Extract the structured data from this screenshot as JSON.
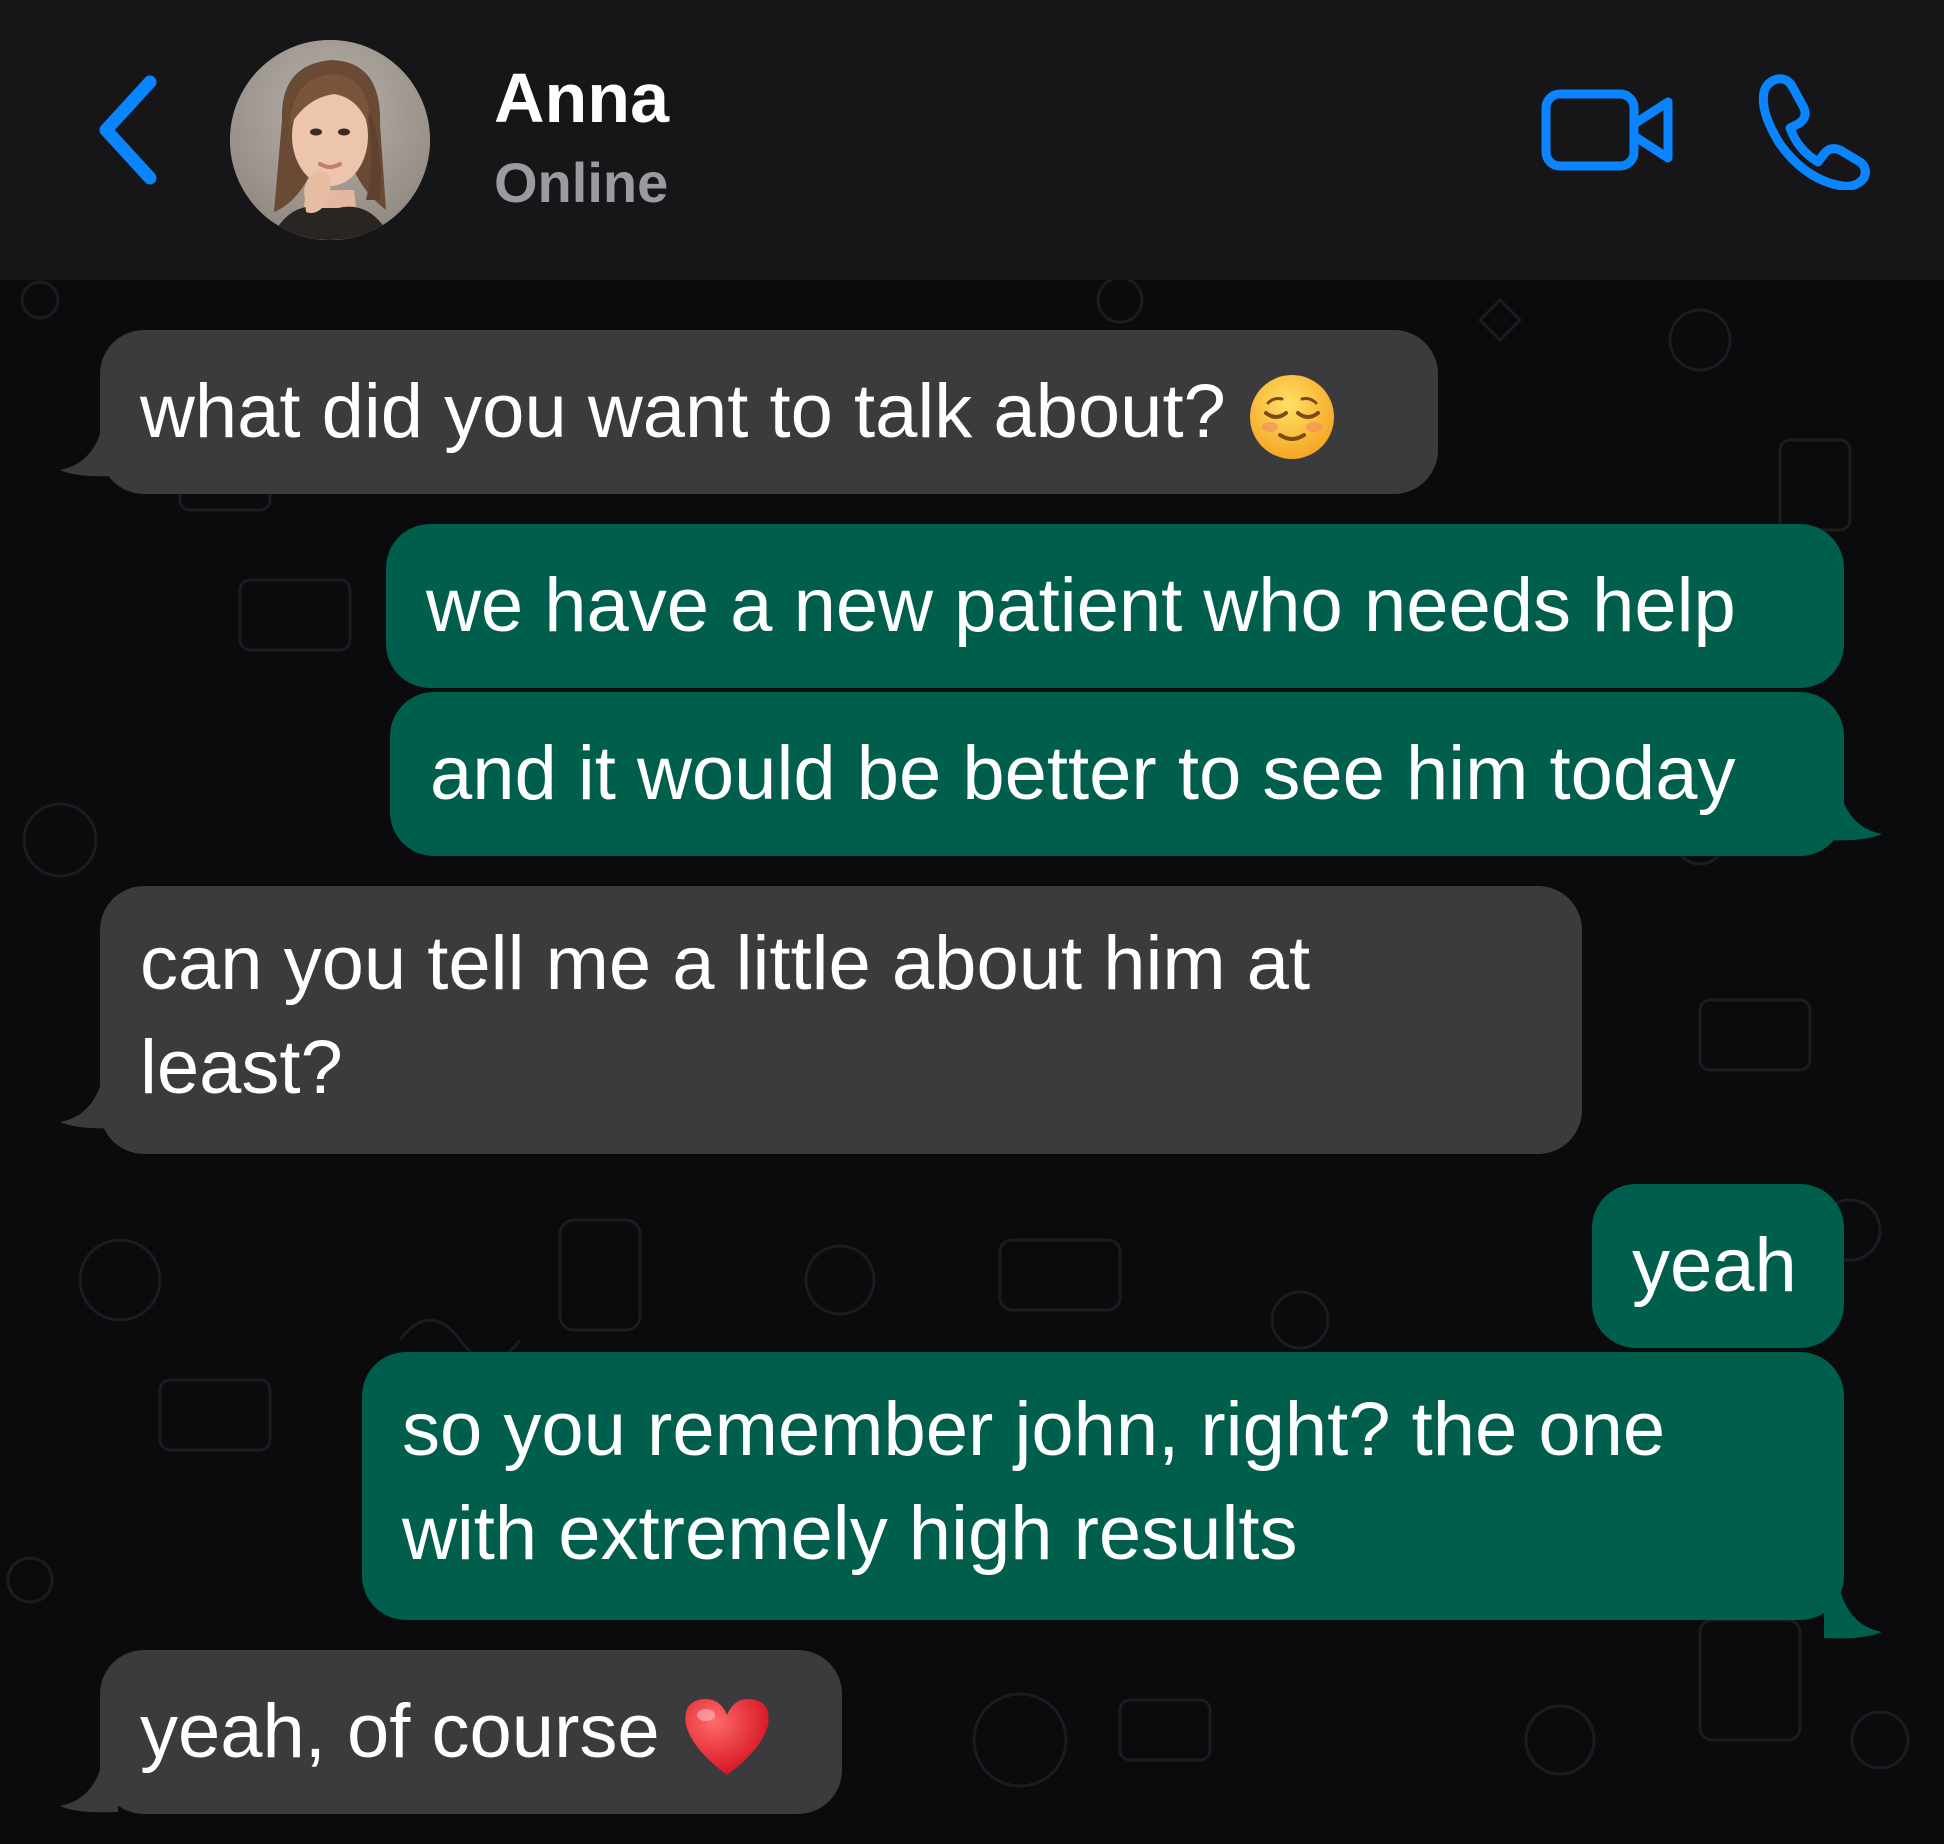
{
  "header": {
    "contact_name": "Anna",
    "contact_status": "Online",
    "accent_color": "#0a84ff"
  },
  "icons": {
    "back": "chevron-left-icon",
    "video": "video-camera-icon",
    "call": "phone-icon"
  },
  "colors": {
    "incoming_bubble": "#3b3b3d",
    "outgoing_bubble": "#005e4d",
    "header_bg": "#161618",
    "chat_bg": "#0b0b0d"
  },
  "messages": [
    {
      "direction": "incoming",
      "text": "what did you want to talk about?",
      "emoji": "relieved-face"
    },
    {
      "direction": "outgoing",
      "text": "we have a new patient who needs help"
    },
    {
      "direction": "outgoing",
      "text": "and it would be better to see him today"
    },
    {
      "direction": "incoming",
      "text": "can you tell me a little about him at least?"
    },
    {
      "direction": "outgoing",
      "text": "yeah"
    },
    {
      "direction": "outgoing",
      "text": "so you remember john, right? the one with extremely high results"
    },
    {
      "direction": "incoming",
      "text": "yeah, of course",
      "emoji": "red-heart"
    }
  ]
}
